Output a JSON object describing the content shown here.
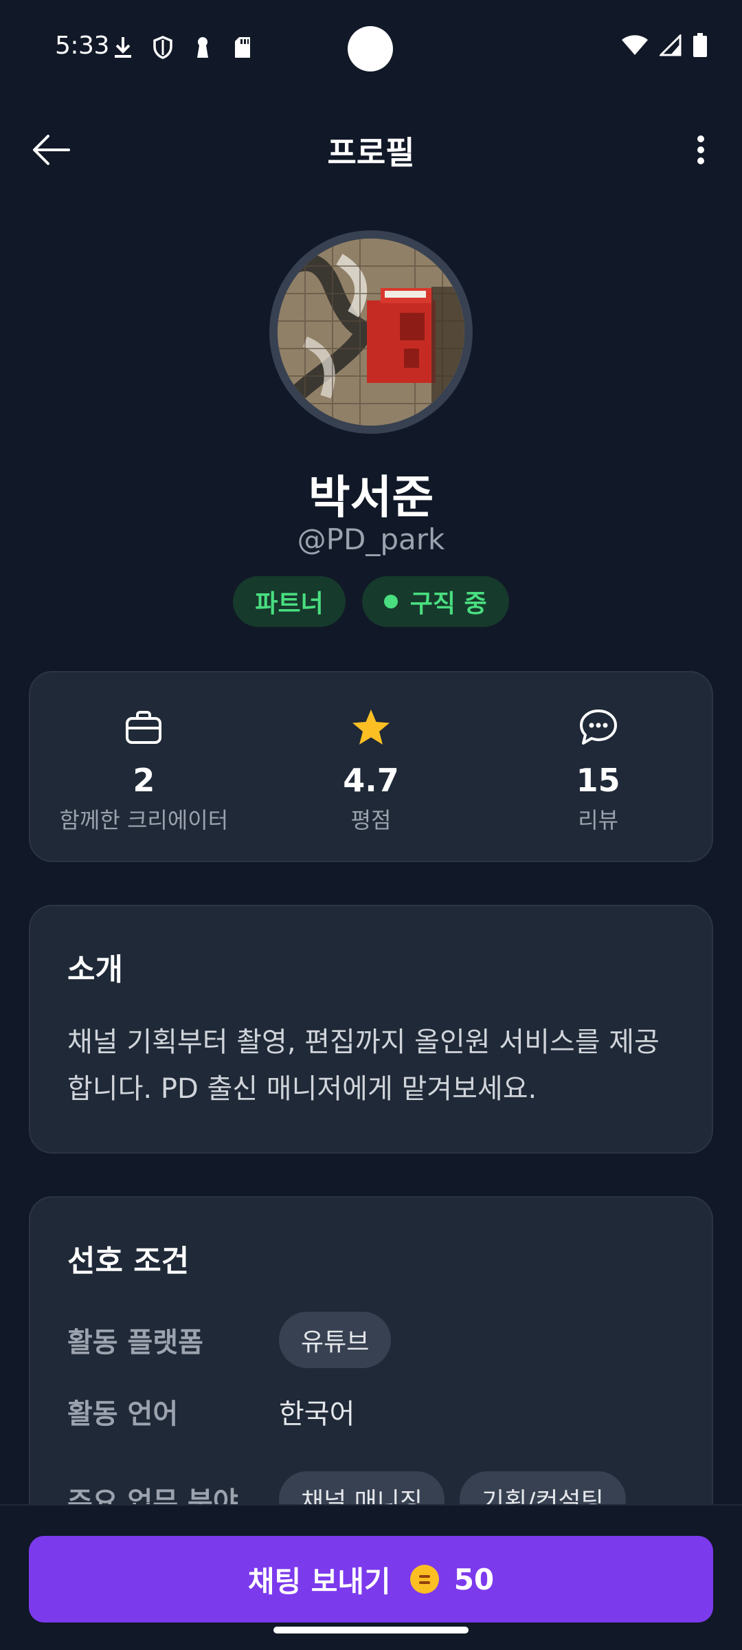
{
  "status_bar": {
    "time": "5:33",
    "left_icons": [
      "download-icon",
      "shield-icon",
      "keyhole-icon",
      "sd-card-icon"
    ],
    "right_icons": [
      "wifi-icon",
      "cell-signal-icon",
      "battery-icon"
    ]
  },
  "app_bar": {
    "title": "프로필",
    "back_icon": "arrow-left-icon",
    "more_icon": "more-vertical-icon"
  },
  "profile": {
    "name": "박서준",
    "handle": "@PD_park",
    "badges": [
      {
        "label": "파트너",
        "dot": false
      },
      {
        "label": "구직 중",
        "dot": true
      }
    ]
  },
  "stats": [
    {
      "icon": "briefcase-icon",
      "value": "2",
      "label": "함께한 크리에이터"
    },
    {
      "icon": "star-icon",
      "value": "4.7",
      "label": "평점"
    },
    {
      "icon": "chat-bubble-icon",
      "value": "15",
      "label": "리뷰"
    }
  ],
  "intro": {
    "title": "소개",
    "text": "채널 기획부터 촬영, 편집까지 올인원 서비스를 제공합니다. PD 출신 매니저에게 맡겨보세요."
  },
  "preferences": {
    "title": "선호 조건",
    "rows": [
      {
        "label": "활동 플랫폼",
        "chips": [
          "유튜브"
        ]
      },
      {
        "label": "활동 언어",
        "value": "한국어"
      },
      {
        "label": "주요 업무 분야",
        "chips": [
          "채널 매니징",
          "기획/컨설팅"
        ]
      }
    ]
  },
  "cta": {
    "label": "채팅 보내기",
    "cost": "50"
  },
  "colors": {
    "background": "#111827",
    "card": "#1f2937",
    "accent": "#7c3aed",
    "badge_text": "#4ade80",
    "star": "#fbbf24"
  }
}
